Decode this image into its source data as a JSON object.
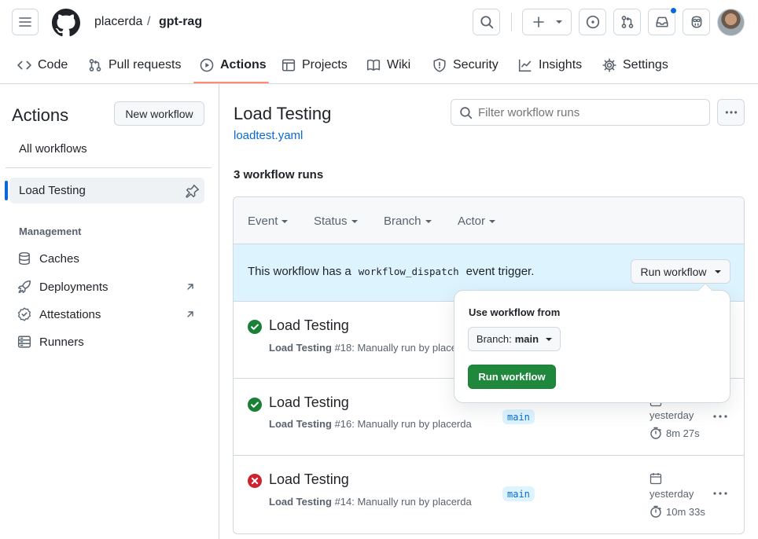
{
  "header": {
    "owner": "placerda",
    "separator": "/",
    "repo": "gpt-rag"
  },
  "repo_nav": {
    "tabs": [
      {
        "label": "Code",
        "icon": "code-icon"
      },
      {
        "label": "Pull requests",
        "icon": "git-pull-request-icon"
      },
      {
        "label": "Actions",
        "icon": "play-icon",
        "selected": true
      },
      {
        "label": "Projects",
        "icon": "table-icon"
      },
      {
        "label": "Wiki",
        "icon": "book-icon"
      },
      {
        "label": "Security",
        "icon": "shield-icon"
      },
      {
        "label": "Insights",
        "icon": "graph-icon"
      },
      {
        "label": "Settings",
        "icon": "gear-icon"
      }
    ]
  },
  "sidebar": {
    "title": "Actions",
    "new_workflow": "New workflow",
    "all_workflows": "All workflows",
    "selected_workflow": "Load Testing",
    "management_heading": "Management",
    "management_items": [
      {
        "label": "Caches",
        "icon": "database-icon"
      },
      {
        "label": "Deployments",
        "icon": "rocket-icon"
      },
      {
        "label": "Attestations",
        "icon": "verified-icon"
      },
      {
        "label": "Runners",
        "icon": "server-icon"
      }
    ]
  },
  "main": {
    "title": "Load Testing",
    "file_link": "loadtest.yaml",
    "filter_placeholder": "Filter workflow runs",
    "runs_count": "3 workflow runs",
    "filters": [
      "Event",
      "Status",
      "Branch",
      "Actor"
    ],
    "banner": {
      "text_before": "This workflow has a",
      "code": "workflow_dispatch",
      "text_after": "event trigger.",
      "button": "Run workflow"
    },
    "runs": [
      {
        "title": "Load Testing",
        "workflow": "Load Testing",
        "detail": "#18: Manually run by placerda",
        "status": "success"
      },
      {
        "title": "Load Testing",
        "workflow": "Load Testing",
        "detail": "#16: Manually run by placerda",
        "branch": "main",
        "when": "yesterday",
        "duration": "8m 27s",
        "status": "success"
      },
      {
        "title": "Load Testing",
        "workflow": "Load Testing",
        "detail": "#14: Manually run by placerda",
        "branch": "main",
        "when": "yesterday",
        "duration": "10m 33s",
        "status": "failure"
      }
    ]
  },
  "popover": {
    "heading": "Use workflow from",
    "branch_prefix": "Branch:",
    "branch": "main",
    "submit": "Run workflow"
  },
  "colors": {
    "accent": "#0969da",
    "success": "#1a7f37",
    "danger": "#cf222e",
    "nav_underline": "#fd8c73",
    "banner_bg": "#ddf4ff"
  }
}
